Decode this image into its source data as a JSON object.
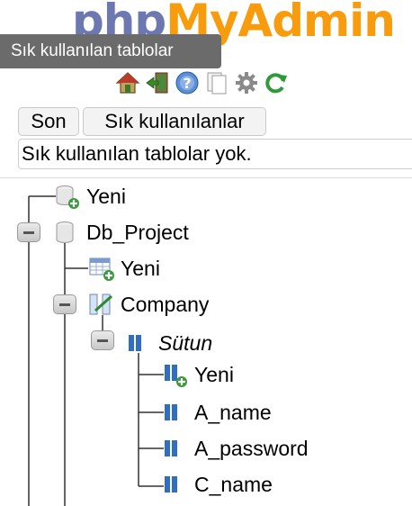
{
  "logo": {
    "text_php": "php",
    "text_myadmin": "MyAdmin"
  },
  "tooltip": "Sık kullanılan tablolar",
  "toolbar": {
    "icons": [
      "home-icon",
      "logout-icon",
      "help-icon",
      "docs-icon",
      "settings-icon",
      "reload-icon"
    ]
  },
  "buttons": {
    "recent": "Son",
    "favorites": "Sık kullanılanlar"
  },
  "favorites_message": "Sık kullanılan tablolar yok.",
  "tree": {
    "new_db": "Yeni",
    "db_name": "Db_Project",
    "new_table": "Yeni",
    "table_name": "Company",
    "columns_group": "Sütun",
    "new_column": "Yeni",
    "columns": [
      "A_name",
      "A_password",
      "C_name"
    ]
  },
  "colors": {
    "tooltip_bg": "#6b6b6b",
    "logo_php": "#6c78af",
    "logo_myadmin": "#f89c0e",
    "column_icon": "#2f6ec2"
  }
}
